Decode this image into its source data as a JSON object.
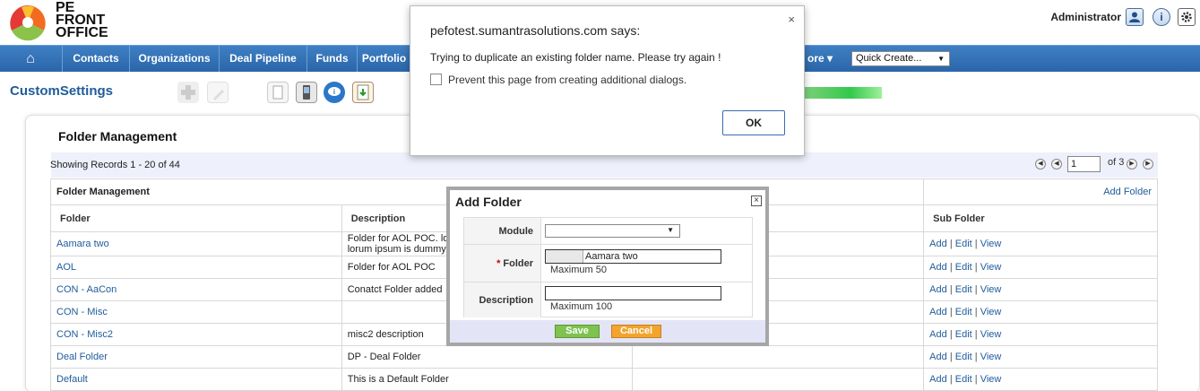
{
  "header": {
    "logo_text_line1": "PE",
    "logo_text_line2": "FRONT",
    "logo_text_line3": "OFFICE",
    "user": "Administrator",
    "icons": [
      "user-icon",
      "info-icon",
      "gear-icon"
    ]
  },
  "nav": {
    "home_icon": "home-icon",
    "items": [
      "Contacts",
      "Organizations",
      "Deal Pipeline",
      "Funds",
      "Portfolio",
      "ore ▾"
    ],
    "quick_create": "Quick Create...",
    "quick_create_arrow": "▼"
  },
  "page": {
    "title": "CustomSettings",
    "toolbar_icons": [
      "add-icon",
      "edit-icon",
      "clipboard-icon",
      "phone-icon",
      "chat-icon",
      "download-icon"
    ],
    "progress_color": "#33c94b"
  },
  "folder_mgmt": {
    "title": "Folder Management",
    "records": "Showing Records 1 - 20 of 44",
    "page_input": "1",
    "page_of": "of 3",
    "section_label": "Folder Management",
    "add_folder_link": "Add Folder",
    "columns": [
      "Folder",
      "Description",
      "",
      "Sub Folder"
    ],
    "rows": [
      {
        "folder": "Aamara two",
        "desc1": "Folder for AOL POC. lo",
        "desc2": "lorum ipsum is dummy"
      },
      {
        "folder": "AOL",
        "desc1": "Folder for AOL POC",
        "desc2": ""
      },
      {
        "folder": "CON - AaCon",
        "desc1": "Conatct Folder added",
        "desc2": ""
      },
      {
        "folder": "CON - Misc",
        "desc1": "",
        "desc2": ""
      },
      {
        "folder": "CON - Misc2",
        "desc1": "misc2 description",
        "desc2": ""
      },
      {
        "folder": "Deal Folder",
        "desc1": "DP - Deal Folder",
        "desc2": ""
      },
      {
        "folder": "Default",
        "desc1": "This is a Default Folder",
        "desc2": ""
      }
    ],
    "sub_add": "Add",
    "sub_edit": "Edit",
    "sub_view": "View",
    "sub_sep": "|"
  },
  "alert": {
    "title": "pefotest.sumantrasolutions.com says:",
    "message": "Trying to duplicate an existing folder name. Please try again !",
    "checkbox_label": "Prevent this page from creating additional dialogs.",
    "ok_label": "OK",
    "close": "×"
  },
  "add_folder": {
    "title": "Add Folder",
    "close": "×",
    "module_label": "Module",
    "module_value": "",
    "module_arrow": "▼",
    "folder_required": "*",
    "folder_label": "Folder",
    "folder_value": "Aamara two",
    "folder_hint": "Maximum 50",
    "description_label": "Description",
    "description_value": "",
    "description_hint": "Maximum 100",
    "save_label": "Save",
    "cancel_label": "Cancel"
  }
}
